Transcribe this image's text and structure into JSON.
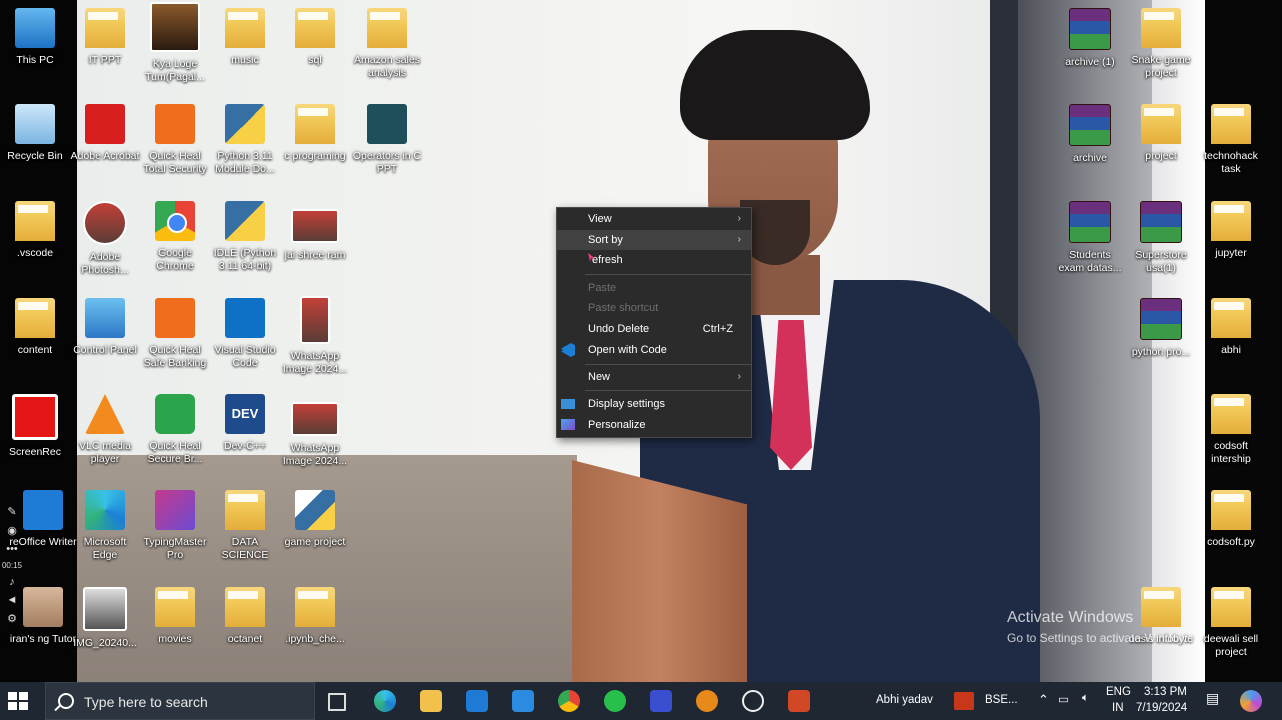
{
  "desktop": {
    "icons": [
      {
        "label": "This PC"
      },
      {
        "label": "Recycle Bin"
      },
      {
        "label": ".vscode"
      },
      {
        "label": "content"
      },
      {
        "label": "ScreenRec"
      },
      {
        "label": "reOffice Writer"
      },
      {
        "label": "iran's ng Tutor"
      },
      {
        "label": "IT PPT"
      },
      {
        "label": "Adobe Acrobat"
      },
      {
        "label": "Adobe Photosh..."
      },
      {
        "label": "Control Panel"
      },
      {
        "label": "VLC media player"
      },
      {
        "label": "Microsoft Edge"
      },
      {
        "label": "IMG_20240..."
      },
      {
        "label": "Kya Loge Tum(Pagal..."
      },
      {
        "label": "Quick Heal Total Security"
      },
      {
        "label": "Google Chrome"
      },
      {
        "label": "Quick Heal Safe Banking"
      },
      {
        "label": "Quick Heal Secure Br..."
      },
      {
        "label": "TypingMaster Pro"
      },
      {
        "label": "movies"
      },
      {
        "label": "music"
      },
      {
        "label": "Python 3.11 Module Do..."
      },
      {
        "label": "IDLE (Python 3.11 64-bit)"
      },
      {
        "label": "Visual Studio Code"
      },
      {
        "label": "Dev-C++"
      },
      {
        "label": "DATA SCIENCE"
      },
      {
        "label": "octanet"
      },
      {
        "label": "sql"
      },
      {
        "label": "c programing"
      },
      {
        "label": "jai shree ram"
      },
      {
        "label": "WhatsApp Image 2024..."
      },
      {
        "label": "WhatsApp Image 2024..."
      },
      {
        "label": "game project"
      },
      {
        "label": ".ipynb_che..."
      },
      {
        "label": "Amazon sales analysis"
      },
      {
        "label": "Operators in C PPT"
      },
      {
        "label": "archive (1)"
      },
      {
        "label": "archive"
      },
      {
        "label": "Students exam datas..."
      },
      {
        "label": "Snake game project"
      },
      {
        "label": "project"
      },
      {
        "label": "Superstore usa(1)"
      },
      {
        "label": "python pro..."
      },
      {
        "label": "oasis infobyte"
      },
      {
        "label": "technohack task"
      },
      {
        "label": "jupyter"
      },
      {
        "label": "abhi"
      },
      {
        "label": "codsoft intership"
      },
      {
        "label": "codsoft.py"
      },
      {
        "label": "deewali sell project"
      }
    ]
  },
  "context_menu": {
    "items": [
      {
        "label": "View",
        "has_submenu": true
      },
      {
        "label": "Sort by",
        "has_submenu": true
      },
      {
        "label": "Refresh",
        "display": "efresh"
      },
      {
        "label": "Paste",
        "disabled": true
      },
      {
        "label": "Paste shortcut",
        "disabled": true
      },
      {
        "label": "Undo Delete",
        "shortcut": "Ctrl+Z"
      },
      {
        "label": "Open with Code"
      },
      {
        "label": "New",
        "has_submenu": true
      },
      {
        "label": "Display settings"
      },
      {
        "label": "Personalize"
      }
    ],
    "submenu_arrow": "›"
  },
  "watermark": {
    "line1": "Activate Windows",
    "line2": "Go to Settings to activate Windows."
  },
  "recorder": {
    "time": "00:15"
  },
  "taskbar": {
    "search_placeholder": "Type here to search",
    "user": "Abhi yadav",
    "bse": "BSE...",
    "lang": "ENG",
    "region": "IN",
    "time": "3:13 PM",
    "date": "7/19/2024"
  }
}
